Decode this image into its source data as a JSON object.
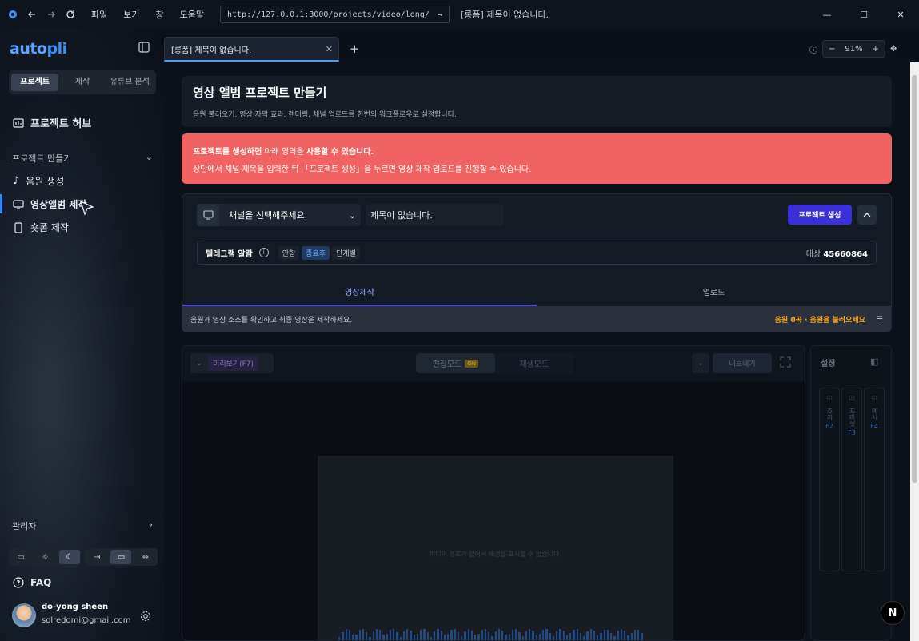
{
  "browser": {
    "menu": [
      "파일",
      "보기",
      "창",
      "도움말"
    ],
    "url": "http://127.0.0.1:3000/projects/video/long/",
    "page_title": "[롱폼] 제목이 없습니다."
  },
  "sidebar": {
    "logo_a": "auto",
    "logo_b": "pli",
    "segments": [
      "프로젝트",
      "제작",
      "유튜브 분석"
    ],
    "hub_label": "프로젝트 허브",
    "section_label": "프로젝트 만들기",
    "items": [
      "음원 생성",
      "영상앨범 제작",
      "숏폼 제작"
    ],
    "admin_label": "관리자",
    "faq_label": "FAQ",
    "user_name": "do-yong sheen",
    "user_email": "solredomi@gmail.com"
  },
  "tabs": {
    "active_tab": "[롱폼] 제목이 없습니다.",
    "zoom": "91%"
  },
  "header": {
    "title": "영상 앨범 프로젝트 만들기",
    "subtitle": "음원 불러오기, 영상·자막 효과, 렌더링, 채널 업로드를 한번의 워크플로우로 설정합니다."
  },
  "alert": {
    "line1_bold": "프로젝트를 생성하면",
    "line1_mid": " 아래 영역을 ",
    "line1_bold2": "사용할 수 있습니다.",
    "line2": "상단에서 채널·제목을 입력한 뒤 「프로젝트 생성」을 누르면 영상 제작·업로드를 진행할 수 있습니다."
  },
  "project": {
    "channel_value": "채널을 선택해주세요.",
    "title_value": "제목이 없습니다.",
    "create_label": "프로젝트 생성",
    "telegram_label": "텔레그램 알람",
    "chips": [
      "안함",
      "종료후",
      "단계별"
    ],
    "active_chip": "종료후",
    "target_label": "대상",
    "target_value": "45660864",
    "subtabs": [
      "영상제작",
      "업로드"
    ],
    "hint": "음원과 영상 소스를 확인하고 최종 영상을 제작하세요.",
    "warn": "음원 0곡 · 음원을 불러오세요"
  },
  "editor": {
    "preview_label": "미리보기(F7)",
    "mode_edit": "편집모드",
    "mode_on": "ON",
    "mode_play": "재생모드",
    "export_label": "내보내기",
    "canvas_msg": "미디어 경로가 없어서 배경을 표시할 수 없습니다."
  },
  "settings": {
    "title": "설정",
    "cols": [
      {
        "label": "효과",
        "key": "F2"
      },
      {
        "label": "프리셋",
        "key": "F3"
      },
      {
        "label": "예시",
        "key": "F4"
      }
    ]
  }
}
